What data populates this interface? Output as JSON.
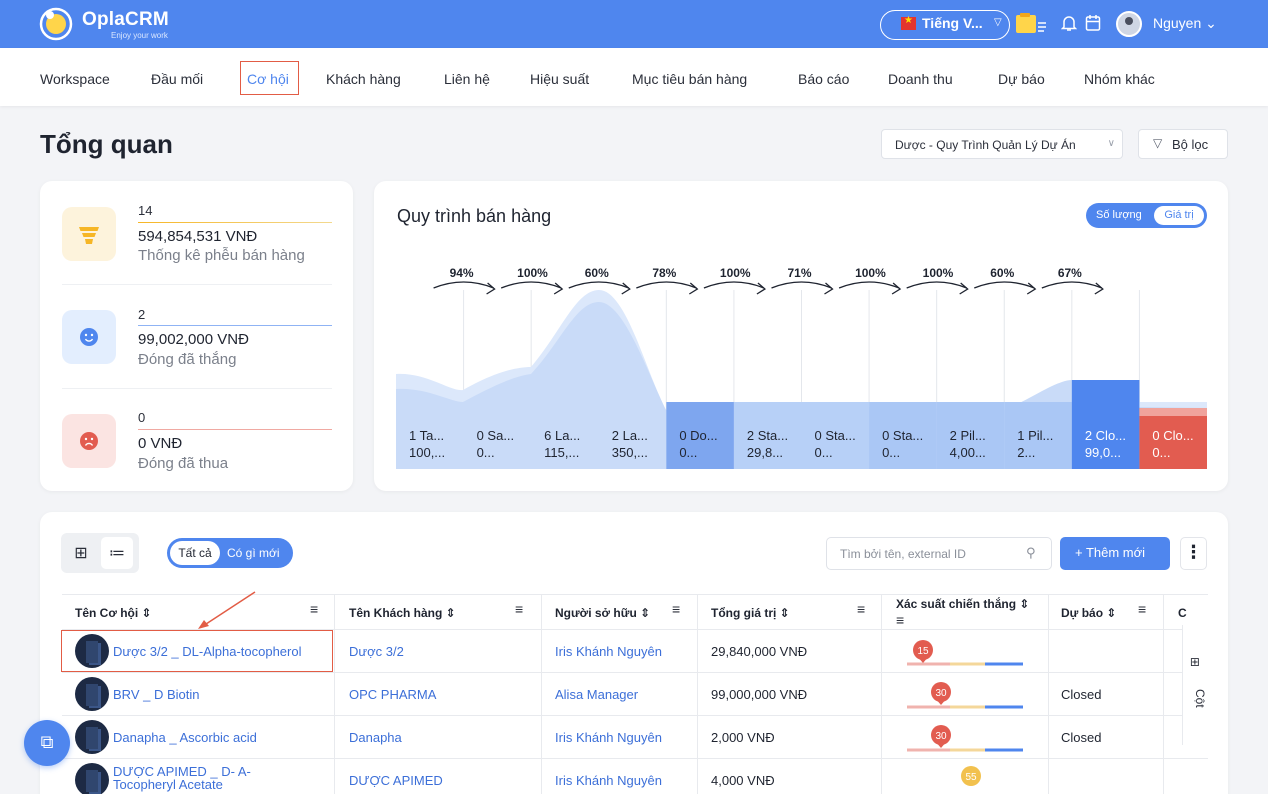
{
  "app": {
    "brand": "OplaCRM",
    "tagline": "Enjoy your work",
    "language": "Tiếng V...",
    "user": "Nguyen"
  },
  "nav": [
    "Workspace",
    "Đầu mối",
    "Cơ hội",
    "Khách hàng",
    "Liên hệ",
    "Hiệu suất",
    "Mục tiêu bán hàng",
    "Báo cáo",
    "Doanh thu",
    "Dự báo",
    "Nhóm khác"
  ],
  "page": {
    "title": "Tổng quan",
    "pipeline": "Dược - Quy Trình Quản Lý Dự Án",
    "filter": "Bộ lọc"
  },
  "stats": [
    {
      "count": "14",
      "value": "594,854,531 VNĐ",
      "label": "Thống kê phễu bán hàng"
    },
    {
      "count": "2",
      "value": "99,002,000 VNĐ",
      "label": "Đóng đã thắng"
    },
    {
      "count": "0",
      "value": "0 VNĐ",
      "label": "Đóng đã thua"
    }
  ],
  "chart_data": {
    "type": "area",
    "title": "Quy trình bán hàng",
    "toggle": [
      "Số lượng",
      "Giá trị"
    ],
    "conversion_pct": [
      "94%",
      "100%",
      "60%",
      "78%",
      "100%",
      "71%",
      "100%",
      "100%",
      "60%",
      "67%"
    ],
    "stages": [
      {
        "name": "1 Ta...",
        "value": "100,..."
      },
      {
        "name": "0 Sa...",
        "value": "0..."
      },
      {
        "name": "6 La...",
        "value": "115,..."
      },
      {
        "name": "2 La...",
        "value": "350,..."
      },
      {
        "name": "0 Do...",
        "value": "0..."
      },
      {
        "name": "2 Sta...",
        "value": "29,8..."
      },
      {
        "name": "0 Sta...",
        "value": "0..."
      },
      {
        "name": "0 Sta...",
        "value": "0..."
      },
      {
        "name": "2 Pil...",
        "value": "4,00..."
      },
      {
        "name": "1 Pil...",
        "value": "2..."
      },
      {
        "name": "2 Clo...",
        "value": "99,0..."
      },
      {
        "name": "0 Clo...",
        "value": "0..."
      }
    ]
  },
  "toolbar": {
    "tab_all": "Tất cả",
    "tab_new": "Có gì mới",
    "search_placeholder": "Tìm bởi tên, external ID",
    "add": "+ Thêm mới",
    "columns": "Cột"
  },
  "table": {
    "headers": [
      "Tên Cơ hội",
      "Tên Khách hàng",
      "Người sở hữu",
      "Tổng giá trị",
      "Xác suất chiến thắng",
      "Dự báo"
    ],
    "rows": [
      {
        "name": "Dược 3/2 _ DL-Alpha-tocopherol",
        "customer": "Dược 3/2",
        "owner": "Iris Khánh Nguyên",
        "total": "29,840,000 VNĐ",
        "prob": "15",
        "forecast": ""
      },
      {
        "name": "BRV _ D Biotin",
        "customer": "OPC PHARMA",
        "owner": "Alisa Manager",
        "total": "99,000,000 VNĐ",
        "prob": "30",
        "forecast": "Closed"
      },
      {
        "name": "Danapha _ Ascorbic acid",
        "customer": "Danapha",
        "owner": "Iris Khánh Nguyên",
        "total": "2,000 VNĐ",
        "prob": "30",
        "forecast": "Closed"
      },
      {
        "name": "DƯỢC APIMED _ D- A-Tocopheryl Acetate",
        "customer": "DƯỢC APIMED",
        "owner": "Iris Khánh Nguyên",
        "total": "4,000 VNĐ",
        "prob": "55",
        "forecast": ""
      }
    ]
  }
}
